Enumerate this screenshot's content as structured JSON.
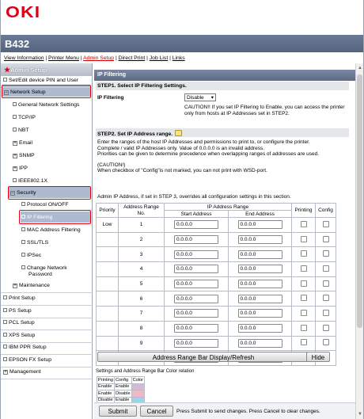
{
  "brand": {
    "logo": "OKI",
    "model": "B432"
  },
  "topnav": [
    {
      "label": "View Information",
      "current": false
    },
    {
      "label": "Printer Menu",
      "current": false
    },
    {
      "label": "Admin Setup",
      "current": true
    },
    {
      "label": "Direct Print",
      "current": false
    },
    {
      "label": "Job List",
      "current": false
    },
    {
      "label": "Links",
      "current": false
    }
  ],
  "sidebar": {
    "title": "Admin Setup",
    "items": [
      {
        "label": "Set/Edit device PIN and User",
        "icon": "doc-icon"
      },
      {
        "label": "Network Setup",
        "icon": "minus-icon"
      },
      {
        "label": "General Network Settings",
        "icon": "doc-icon"
      },
      {
        "label": "TCP/IP",
        "icon": "doc-icon"
      },
      {
        "label": "NBT",
        "icon": "doc-icon"
      },
      {
        "label": "Email",
        "icon": "plus-icon"
      },
      {
        "label": "SNMP",
        "icon": "plus-icon"
      },
      {
        "label": "IPP",
        "icon": "plus-icon"
      },
      {
        "label": "IEEE802.1X",
        "icon": "doc-icon"
      },
      {
        "label": "Security",
        "icon": "minus-icon"
      },
      {
        "label": "Protocol ON/OFF",
        "icon": "doc-icon"
      },
      {
        "label": "IP Filtering",
        "icon": "doc-icon"
      },
      {
        "label": "MAC Address Filtering",
        "icon": "doc-icon"
      },
      {
        "label": "SSL/TLS",
        "icon": "doc-icon"
      },
      {
        "label": "IPSec",
        "icon": "doc-icon"
      },
      {
        "label": "Change Network",
        "icon": "doc-icon",
        "label2": "Password"
      },
      {
        "label": "Maintenance",
        "icon": "plus-icon"
      },
      {
        "label": "Print Setup",
        "icon": "doc-icon"
      },
      {
        "label": "PS Setup",
        "icon": "doc-icon"
      },
      {
        "label": "PCL Setup",
        "icon": "doc-icon"
      },
      {
        "label": "XPS Setup",
        "icon": "doc-icon"
      },
      {
        "label": "IBM PPR Setup",
        "icon": "doc-icon"
      },
      {
        "label": "EPSON FX Setup",
        "icon": "doc-icon"
      },
      {
        "label": "Management",
        "icon": "plus-icon"
      }
    ]
  },
  "panel": {
    "title": "IP Filtering",
    "step1": "STEP1.  Select IP Filtering Settings.",
    "ipf_label": "IP Filtering",
    "ipf_value": "Disable",
    "caution1": "CAUTION!! If you set IP Filtering to Enable, you can access the printer only from hosts at IP Addresses set in STEP2.",
    "step2": "STEP2.  Set IP Address range.",
    "desc1": "Enter the ranges of the host IP Addresses and permissions to print to, or configure the printer.",
    "desc2": "Complete / valid IP Addresses only. Value of 0.0.0.0 is an invalid address.",
    "desc3": "Priorities can be given to determine precedence when overlapping ranges of addresses are used.",
    "caution_head": "(CAUTION!)",
    "caution2": "When checkbox of \"Config\"is not marked, you can not print with WSD-port.",
    "admin_note": "Admin IP Address, if set in STEP 3, overrides all configuration settings in this section."
  },
  "table": {
    "h_priority": "Priority",
    "h_range_no": "Address Range",
    "h_range_no2": "No.",
    "h_ip_range": "IP Address Range",
    "h_start": "Start Address",
    "h_end": "End Address",
    "h_printing": "Printing",
    "h_config": "Config",
    "rows": [
      {
        "priority": "Low",
        "no": "1",
        "start": "0.0.0.0",
        "end": "0.0.0.0"
      },
      {
        "priority": "",
        "no": "2",
        "start": "0.0.0.0",
        "end": "0.0.0.0"
      },
      {
        "priority": "",
        "no": "3",
        "start": "0.0.0.0",
        "end": "0.0.0.0"
      },
      {
        "priority": "",
        "no": "4",
        "start": "0.0.0.0",
        "end": "0.0.0.0"
      },
      {
        "priority": "",
        "no": "5",
        "start": "0.0.0.0",
        "end": "0.0.0.0"
      },
      {
        "priority": "",
        "no": "6",
        "start": "0.0.0.0",
        "end": "0.0.0.0"
      },
      {
        "priority": "",
        "no": "7",
        "start": "0.0.0.0",
        "end": "0.0.0.0"
      },
      {
        "priority": "",
        "no": "8",
        "start": "0.0.0.0",
        "end": "0.0.0.0"
      },
      {
        "priority": "",
        "no": "9",
        "start": "0.0.0.0",
        "end": "0.0.0.0"
      },
      {
        "priority": "High",
        "no": "10",
        "start": "0.0.0.0",
        "end": "0.0.0.0"
      }
    ]
  },
  "range_bar_button": "Address Range Bar Display/Refresh",
  "hide_button": "Hide",
  "relation": {
    "title": "Settings and Address Range Bar Color relation",
    "headers": [
      "Printing",
      "Config",
      "Color"
    ],
    "rows": [
      {
        "printing": "Enable",
        "config": "Enable",
        "color": "#d9b8d4"
      },
      {
        "printing": "Enable",
        "config": "Disable",
        "color": "#f3b6c8"
      },
      {
        "printing": "Disable",
        "config": "Enable",
        "color": "#9ed3ec"
      }
    ]
  },
  "footer": {
    "submit": "Submit",
    "cancel": "Cancel",
    "note": "Press Submit to send changes. Press Cancel to clear changes."
  },
  "colors": {
    "brand_red": "#e10018",
    "highlight_border": "#e8000d"
  }
}
